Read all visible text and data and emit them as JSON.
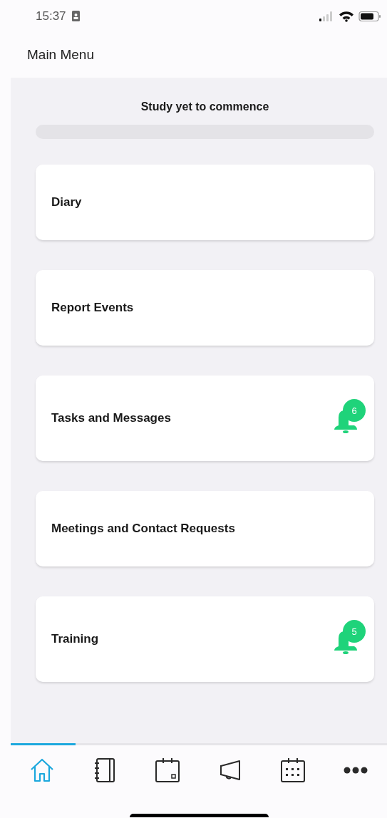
{
  "status_bar": {
    "time": "15:37"
  },
  "header": {
    "title": "Main Menu"
  },
  "study": {
    "status": "Study yet to commence",
    "level": 0
  },
  "menu_items": [
    {
      "title": "Diary"
    },
    {
      "title": "Report Events"
    },
    {
      "title": "Tasks and Messages",
      "badge": "6"
    },
    {
      "title": "Meetings and Contact Requests"
    },
    {
      "title": "Training",
      "badge": "5"
    }
  ],
  "tabs": [
    {
      "kind": "home",
      "selected": true
    },
    {
      "kind": "diary",
      "selected": false
    },
    {
      "kind": "appointment",
      "selected": false
    },
    {
      "kind": "announcements",
      "selected": false
    },
    {
      "kind": "calendar",
      "selected": false
    },
    {
      "kind": "more",
      "selected": false
    }
  ]
}
